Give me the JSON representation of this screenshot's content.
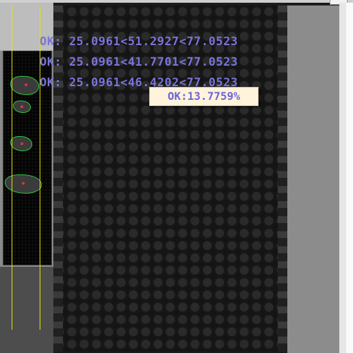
{
  "inspection": {
    "results": [
      {
        "text": "OK: 25.0961<51.2927<77.0523"
      },
      {
        "text": "OK: 25.0961<41.7701<77.0523"
      },
      {
        "text": "OK: 25.0961<46.4202<77.0523"
      }
    ],
    "percent_badge": "OK:13.7759%"
  },
  "colors": {
    "result_text": "#7a74d8",
    "badge_text": "#6f67d6",
    "badge_background": "#fff3dc",
    "guide_line": "#e6e600",
    "contour": "#2ecc40"
  }
}
